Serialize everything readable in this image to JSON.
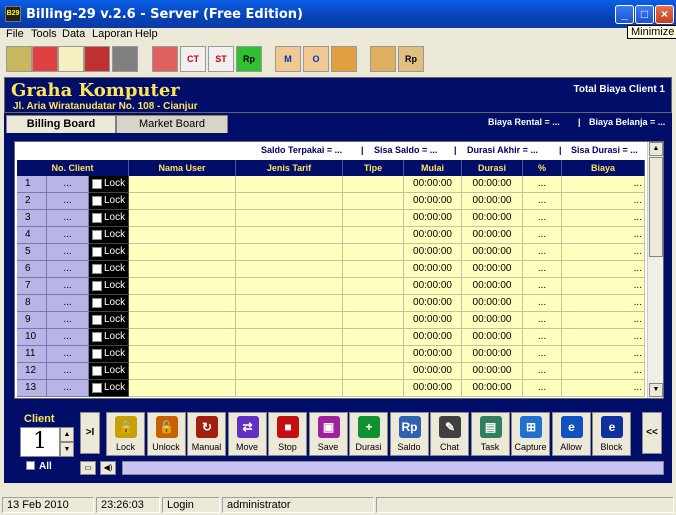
{
  "window": {
    "title": "Billing-29 v.2.6 - Server (Free Edition)",
    "app_icon_text": "B29",
    "tooltip": "Minimize"
  },
  "menu": [
    "File",
    "Tools",
    "Data",
    "Laporan",
    "Help"
  ],
  "toolbar": [
    {
      "name": "calculator-icon",
      "text": ""
    },
    {
      "name": "key-icon",
      "text": ""
    },
    {
      "name": "notepad-icon",
      "text": ""
    },
    {
      "name": "mail-icon",
      "text": ""
    },
    {
      "name": "x-icon",
      "text": ""
    },
    {
      "name": "stop-icon",
      "text": ""
    },
    {
      "name": "ct-icon",
      "text": "CT"
    },
    {
      "name": "st-icon",
      "text": "ST"
    },
    {
      "name": "rp-icon",
      "text": "Rp"
    },
    {
      "name": "member-icon",
      "text": "M"
    },
    {
      "name": "operator-icon",
      "text": "O"
    },
    {
      "name": "food-icon",
      "text": ""
    },
    {
      "name": "shop-icon",
      "text": ""
    },
    {
      "name": "shop-rp-icon",
      "text": "Rp"
    }
  ],
  "header": {
    "company": "Graha Komputer",
    "address": "Jl. Aria Wiratanudatar No. 108 - Cianjur",
    "total_client": "Total Biaya Client 1"
  },
  "tabs": {
    "billing": "Billing Board",
    "market": "Market Board",
    "biaya_rental": "Biaya Rental = ...",
    "biaya_belanja": "Biaya Belanja = ..."
  },
  "summary": {
    "saldo_terpakai": "Saldo Terpakai = ...",
    "sisa_saldo": "Sisa Saldo = ...",
    "durasi_akhir": "Durasi Akhir = ...",
    "sisa_durasi": "Sisa Durasi = ...",
    "sep": "|"
  },
  "table": {
    "headers": {
      "no_client": "No. Client",
      "nama_user": "Nama User",
      "jenis_tarif": "Jenis Tarif",
      "tipe": "Tipe",
      "mulai": "Mulai",
      "durasi": "Durasi",
      "pct": "%",
      "biaya": "Biaya"
    },
    "rows": [
      {
        "no": "1",
        "dots": "...",
        "lock": "Lock",
        "mulai": "00:00:00",
        "durasi": "00:00:00",
        "pct": "...",
        "biaya": "..."
      },
      {
        "no": "2",
        "dots": "...",
        "lock": "Lock",
        "mulai": "00:00:00",
        "durasi": "00:00:00",
        "pct": "...",
        "biaya": "..."
      },
      {
        "no": "3",
        "dots": "...",
        "lock": "Lock",
        "mulai": "00:00:00",
        "durasi": "00:00:00",
        "pct": "...",
        "biaya": "..."
      },
      {
        "no": "4",
        "dots": "...",
        "lock": "Lock",
        "mulai": "00:00:00",
        "durasi": "00:00:00",
        "pct": "...",
        "biaya": "..."
      },
      {
        "no": "5",
        "dots": "...",
        "lock": "Lock",
        "mulai": "00:00:00",
        "durasi": "00:00:00",
        "pct": "...",
        "biaya": "..."
      },
      {
        "no": "6",
        "dots": "...",
        "lock": "Lock",
        "mulai": "00:00:00",
        "durasi": "00:00:00",
        "pct": "...",
        "biaya": "..."
      },
      {
        "no": "7",
        "dots": "...",
        "lock": "Lock",
        "mulai": "00:00:00",
        "durasi": "00:00:00",
        "pct": "...",
        "biaya": "..."
      },
      {
        "no": "8",
        "dots": "...",
        "lock": "Lock",
        "mulai": "00:00:00",
        "durasi": "00:00:00",
        "pct": "...",
        "biaya": "..."
      },
      {
        "no": "9",
        "dots": "...",
        "lock": "Lock",
        "mulai": "00:00:00",
        "durasi": "00:00:00",
        "pct": "...",
        "biaya": "..."
      },
      {
        "no": "10",
        "dots": "...",
        "lock": "Lock",
        "mulai": "00:00:00",
        "durasi": "00:00:00",
        "pct": "...",
        "biaya": "..."
      },
      {
        "no": "11",
        "dots": "...",
        "lock": "Lock",
        "mulai": "00:00:00",
        "durasi": "00:00:00",
        "pct": "...",
        "biaya": "..."
      },
      {
        "no": "12",
        "dots": "...",
        "lock": "Lock",
        "mulai": "00:00:00",
        "durasi": "00:00:00",
        "pct": "...",
        "biaya": "..."
      },
      {
        "no": "13",
        "dots": "...",
        "lock": "Lock",
        "mulai": "00:00:00",
        "durasi": "00:00:00",
        "pct": "...",
        "biaya": "..."
      }
    ]
  },
  "client": {
    "label": "Client",
    "value": "1",
    "all_label": "All"
  },
  "nav": {
    "first": ">I",
    "back": "<<"
  },
  "actions": [
    {
      "name": "lock",
      "label": "Lock",
      "icon": "lock-icon",
      "color": "#c8a000",
      "glyph": "🔒"
    },
    {
      "name": "unlock",
      "label": "Unlock",
      "icon": "unlock-icon",
      "color": "#c86000",
      "glyph": "🔓"
    },
    {
      "name": "manual",
      "label": "Manual",
      "icon": "manual-icon",
      "color": "#a02010",
      "glyph": "↻"
    },
    {
      "name": "move",
      "label": "Move",
      "icon": "move-icon",
      "color": "#6030c0",
      "glyph": "⇄"
    },
    {
      "name": "stop",
      "label": "Stop",
      "icon": "stop-icon",
      "color": "#c01010",
      "glyph": "■"
    },
    {
      "name": "save",
      "label": "Save",
      "icon": "save-icon",
      "color": "#a020a0",
      "glyph": "▣"
    },
    {
      "name": "durasi",
      "label": "Durasi",
      "icon": "durasi-icon",
      "color": "#109030",
      "glyph": "+"
    },
    {
      "name": "saldo",
      "label": "Saldo",
      "icon": "saldo-icon",
      "color": "#3060b0",
      "glyph": "Rp"
    },
    {
      "name": "chat",
      "label": "Chat",
      "icon": "chat-icon",
      "color": "#404040",
      "glyph": "✎"
    },
    {
      "name": "task",
      "label": "Task",
      "icon": "task-icon",
      "color": "#308060",
      "glyph": "▤"
    },
    {
      "name": "capture",
      "label": "Capture",
      "icon": "capture-icon",
      "color": "#2070d0",
      "glyph": "⊞"
    },
    {
      "name": "allow",
      "label": "Allow",
      "icon": "allow-icon",
      "color": "#1050c0",
      "glyph": "e"
    },
    {
      "name": "block",
      "label": "Block",
      "icon": "block-icon",
      "color": "#1030a0",
      "glyph": "e"
    }
  ],
  "status": {
    "date": "13 Feb 2010",
    "time": "23:26:03",
    "login": "Login",
    "user": "administrator"
  }
}
